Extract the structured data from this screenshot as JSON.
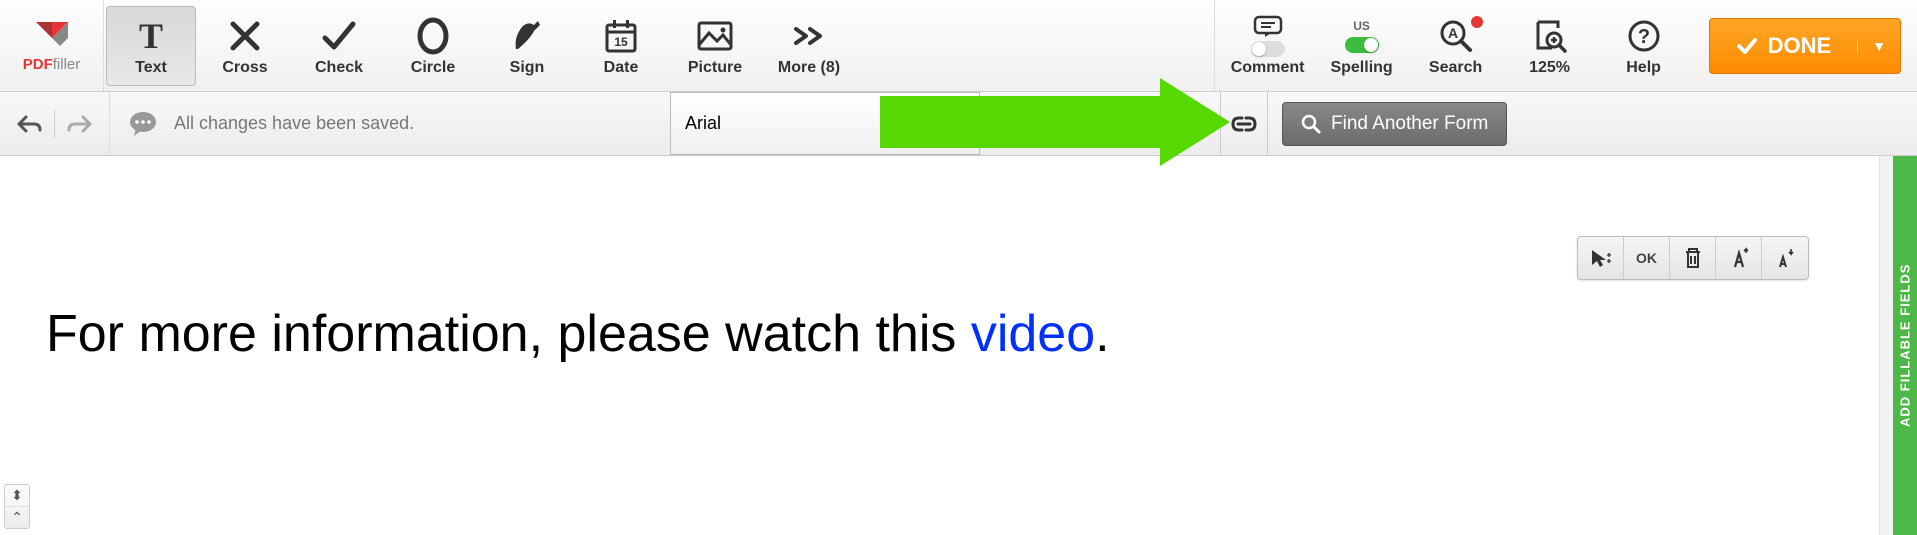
{
  "logo": {
    "brand_a": "PDF",
    "brand_b": "filler"
  },
  "tools": {
    "text": "Text",
    "cross": "Cross",
    "check": "Check",
    "circle": "Circle",
    "sign": "Sign",
    "date": "Date",
    "picture": "Picture",
    "more": "More (8)",
    "comment": "Comment",
    "spelling": "Spelling",
    "spelling_region": "US",
    "search": "Search",
    "zoom": "125%",
    "help": "Help"
  },
  "done_label": "DONE",
  "sub": {
    "status": "All changes have been saved.",
    "font": "Arial",
    "find_btn": "Find Another Form"
  },
  "palette": {
    "ok": "OK"
  },
  "doc": {
    "line_a": "For more information, please watch this ",
    "link": "video",
    "line_b": "."
  },
  "rail": "ADD FILLABLE FIELDS"
}
